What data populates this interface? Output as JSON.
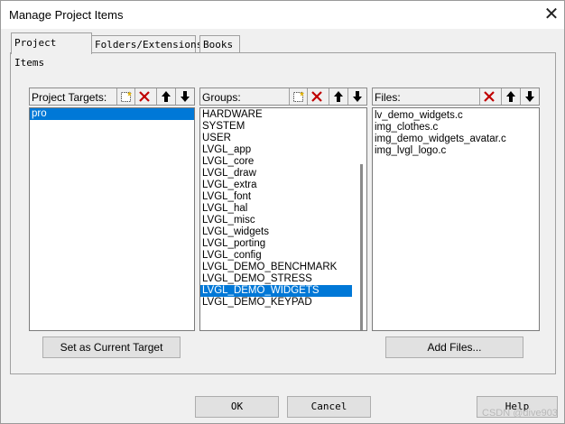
{
  "window": {
    "title": "Manage Project Items",
    "close_glyph": "✕"
  },
  "tabs": [
    {
      "label": "Project Items",
      "active": true
    },
    {
      "label": "Folders/Extensions",
      "active": false
    },
    {
      "label": "Books",
      "active": false
    }
  ],
  "targets": {
    "label": "Project Targets:",
    "items": [
      "pro"
    ],
    "selected_index": 0,
    "button": "Set as Current Target"
  },
  "groups": {
    "label": "Groups:",
    "items": [
      "HARDWARE",
      "SYSTEM",
      "USER",
      "LVGL_app",
      "LVGL_core",
      "LVGL_draw",
      "LVGL_extra",
      "LVGL_font",
      "LVGL_hal",
      "LVGL_misc",
      "LVGL_widgets",
      "LVGL_porting",
      "LVGL_config",
      "LVGL_DEMO_BENCHMARK",
      "LVGL_DEMO_STRESS",
      "LVGL_DEMO_WIDGETS",
      "LVGL_DEMO_KEYPAD"
    ],
    "selected_index": 15
  },
  "files": {
    "label": "Files:",
    "items": [
      "lv_demo_widgets.c",
      "img_clothes.c",
      "img_demo_widgets_avatar.c",
      "img_lvgl_logo.c"
    ],
    "button": "Add Files..."
  },
  "footer": {
    "ok": "OK",
    "cancel": "Cancel",
    "help": "Help"
  },
  "watermark": "CSDN @dive903",
  "colors": {
    "selection": "#0078d7",
    "delete_icon": "#c00000"
  },
  "icons": [
    "new-item-icon",
    "delete-icon",
    "move-up-icon",
    "move-down-icon"
  ]
}
